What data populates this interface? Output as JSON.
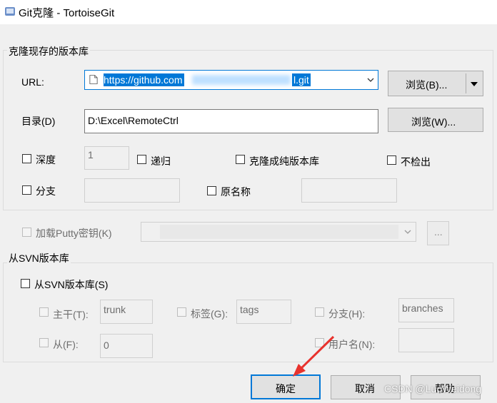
{
  "window": {
    "title": "Git克隆 - TortoiseGit"
  },
  "clone_group": {
    "label": "克隆现存的版本库",
    "url_label": "URL:",
    "url_value_prefix": "https://github.com",
    "url_value_suffix": "l.git",
    "browse_url_label": "浏览(B)...",
    "dir_label": "目录(D)",
    "dir_value": "D:\\Excel\\RemoteCtrl",
    "browse_dir_label": "浏览(W)...",
    "depth_label": "深度",
    "depth_value": "1",
    "recursive_label": "递归",
    "bare_label": "克隆成纯版本库",
    "no_checkout_label": "不检出",
    "branch_label": "分支",
    "branch_value": "",
    "origin_label": "原名称",
    "origin_value": ""
  },
  "putty": {
    "label": "加载Putty密钥(K)",
    "value": "",
    "browse_label": "..."
  },
  "svn_group": {
    "label": "从SVN版本库",
    "from_svn_label": "从SVN版本库(S)",
    "trunk_label": "主干(T):",
    "trunk_value": "trunk",
    "tags_label": "标签(G):",
    "tags_value": "tags",
    "branches_label": "分支(H):",
    "branches_value": "branches",
    "from_label": "从(F):",
    "from_value": "0",
    "username_label": "用户名(N):",
    "username_value": ""
  },
  "buttons": {
    "ok": "确定",
    "cancel": "取消",
    "help": "帮助"
  },
  "watermark": "CSDN @LuoWeidong",
  "colors": {
    "accent": "#0078d7",
    "arrow": "#e8322d"
  }
}
